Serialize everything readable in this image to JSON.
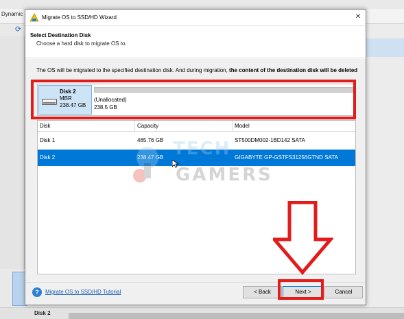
{
  "background": {
    "menu_label": "Dynamic",
    "bottom_disk_label": "Disk 2"
  },
  "dialog": {
    "title": "Migrate OS to SSD/HD Wizard",
    "close_label": "✕",
    "header_title": "Select Destination Disk",
    "header_subtitle": "Choose a hard disk to migrate OS to.",
    "note_prefix": "The OS will be migrated to the specified destination disk. And during migration, ",
    "note_bold": "the content of the destination disk will be deleted",
    "disk_map": {
      "name": "Disk 2",
      "type": "MBR",
      "size": "238.47 GB",
      "partition_label": "(Unallocated)",
      "partition_size": "238.5 GB"
    },
    "table": {
      "columns": [
        "Disk",
        "Capacity",
        "Model"
      ],
      "rows": [
        {
          "disk": "Disk 1",
          "capacity": "465.76 GB",
          "model": "ST500DM002-1BD142 SATA"
        },
        {
          "disk": "Disk 2",
          "capacity": "238.47 GB",
          "model": "GIGABYTE GP-GSTFS31256GTND SATA"
        }
      ],
      "selected_row": 1
    },
    "footer": {
      "help_icon": "?",
      "help_link": "Migrate OS to SSD/HD Tutorial",
      "back_label": "< Back",
      "next_label": "Next >",
      "cancel_label": "Cancel"
    }
  },
  "watermark": {
    "line1": "TECH",
    "line2": "GAMERS"
  },
  "colors": {
    "highlight_red": "#e21b1b",
    "selection_blue": "#0078d7",
    "tile_blue": "#cde4f7"
  }
}
